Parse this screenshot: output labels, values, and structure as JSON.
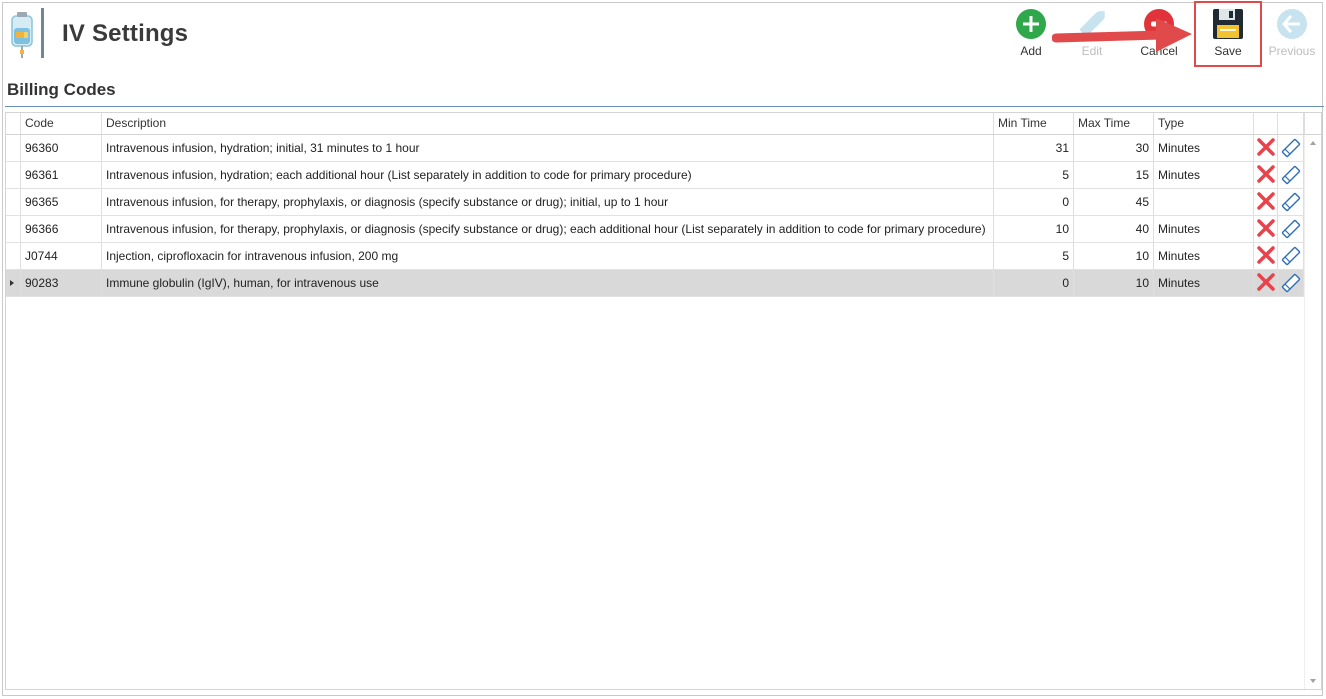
{
  "window": {
    "title": "IV Settings"
  },
  "toolbar": {
    "add_label": "Add",
    "edit_label": "Edit",
    "cancel_label": "Cancel",
    "save_label": "Save",
    "previous_label": "Previous"
  },
  "section": {
    "title": "Billing Codes"
  },
  "grid": {
    "columns": [
      "Code",
      "Description",
      "Min Time",
      "Max Time",
      "Type"
    ],
    "rows": [
      {
        "code": "96360",
        "description": "Intravenous infusion, hydration; initial, 31 minutes to 1 hour",
        "min": "31",
        "max": "30",
        "type": "Minutes"
      },
      {
        "code": "96361",
        "description": "Intravenous infusion, hydration; each additional hour (List separately in addition to code for primary procedure)",
        "min": "5",
        "max": "15",
        "type": "Minutes"
      },
      {
        "code": "96365",
        "description": "Intravenous infusion, for therapy, prophylaxis, or diagnosis (specify substance or drug); initial, up to 1 hour",
        "min": "0",
        "max": "45",
        "type": ""
      },
      {
        "code": "96366",
        "description": "Intravenous infusion, for therapy, prophylaxis, or diagnosis (specify substance or drug); each additional hour (List separately in addition to code for primary procedure)",
        "min": "10",
        "max": "40",
        "type": "Minutes"
      },
      {
        "code": "J0744",
        "description": "Injection, ciprofloxacin for intravenous infusion, 200 mg",
        "min": "5",
        "max": "10",
        "type": "Minutes"
      },
      {
        "code": "90283",
        "description": "Immune globulin (IgIV), human, for intravenous use",
        "min": "0",
        "max": "10",
        "type": "Minutes"
      }
    ],
    "selected_row": 5
  },
  "colors": {
    "accent_rule": "#6a8fb8",
    "add_green": "#2ea84a",
    "cancel_red": "#e0333a",
    "delete_red": "#e8424b",
    "edit_blue": "#2e6fb8",
    "annotation_red": "#e04a4a"
  },
  "icons": {
    "app": "iv-bag-icon",
    "add": "plus-circle-icon",
    "edit": "pencil-icon",
    "cancel": "minus-circle-icon",
    "save": "floppy-disk-icon",
    "previous": "arrow-left-circle-icon",
    "row_delete": "x-icon",
    "row_edit": "pencil-icon"
  }
}
